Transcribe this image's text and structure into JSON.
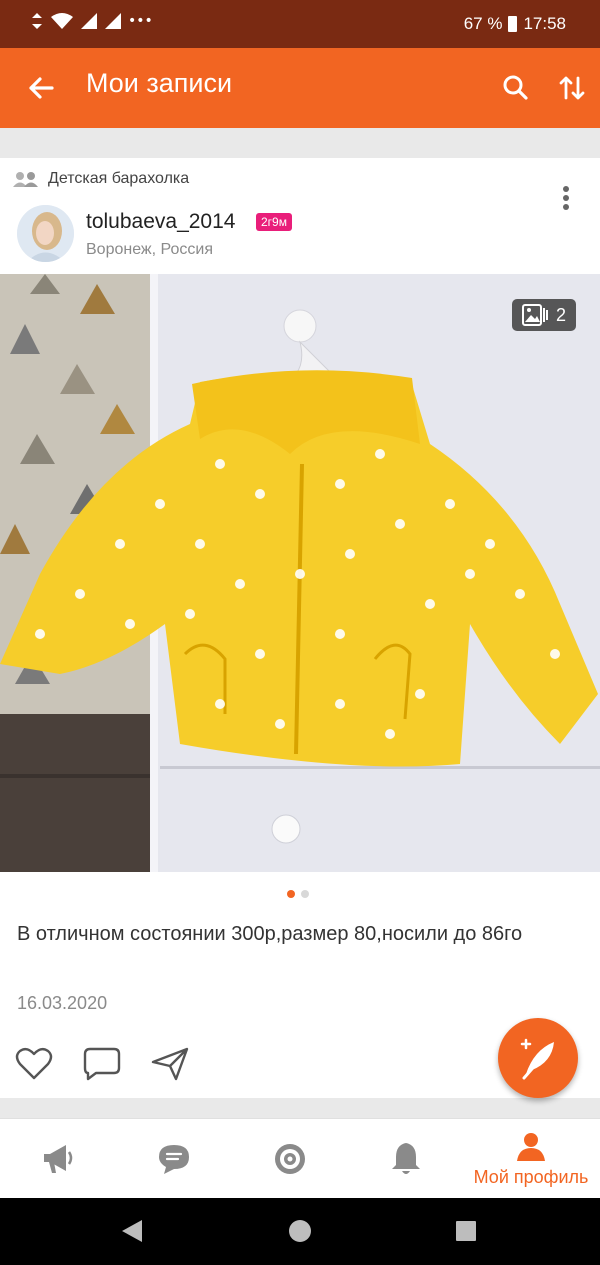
{
  "status_bar": {
    "left_icons": [
      "sync-icon",
      "wifi-icon",
      "signal-icon",
      "signal-icon",
      "more-dots"
    ],
    "battery": "67 %",
    "time": "17:58"
  },
  "app_bar": {
    "title": "Мои записи",
    "back_icon": "arrow-left-icon",
    "search_icon": "search-icon",
    "sort_icon": "sort-icon"
  },
  "post": {
    "group": "Детская барахолка",
    "username": "tolubaeva_2014",
    "age_badge": "2г9м",
    "location": "Воронеж, Россия",
    "photo_count": "2",
    "description": "В отличном состоянии 300р,размер 80,носили до 86го",
    "date": "16.03.2020"
  },
  "bottom_nav": {
    "items": [
      {
        "icon": "megaphone-icon",
        "label": ""
      },
      {
        "icon": "chat-icon",
        "label": ""
      },
      {
        "icon": "target-icon",
        "label": ""
      },
      {
        "icon": "bell-icon",
        "label": ""
      },
      {
        "icon": "profile-icon",
        "label": "Мой профиль"
      }
    ]
  },
  "colors": {
    "accent": "#f26522",
    "status_bar": "#7a2a12",
    "badge": "#e91e7a"
  }
}
